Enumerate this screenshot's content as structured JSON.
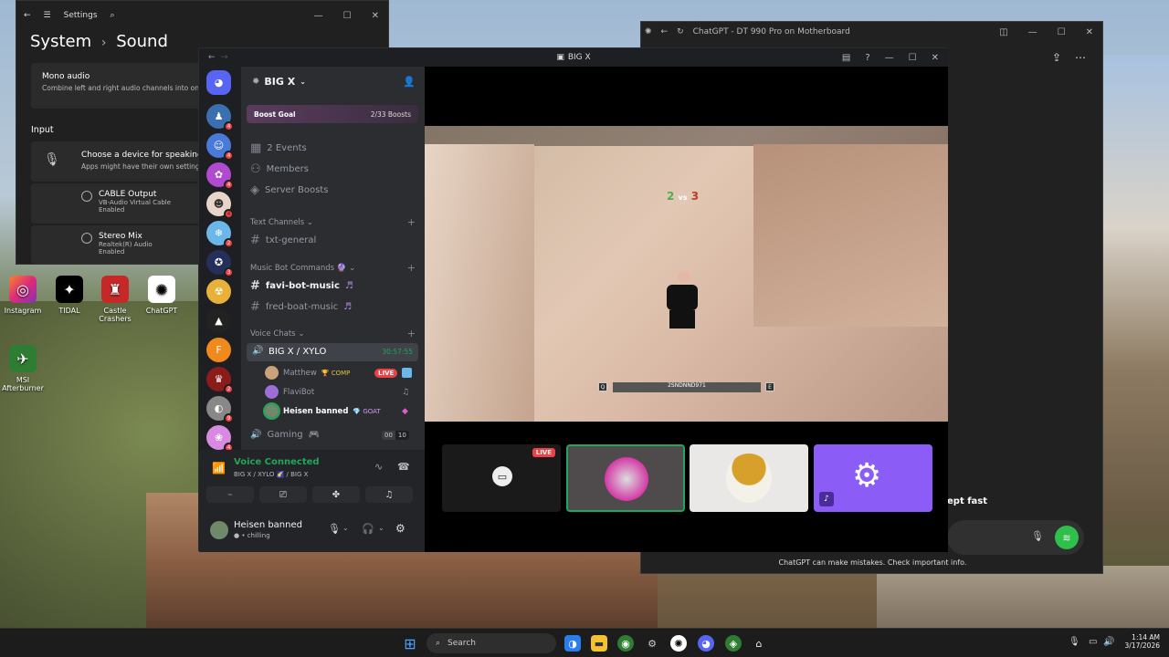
{
  "desktop": {
    "icons": [
      {
        "label": "Instagram",
        "glyph": "◎",
        "color": "#d6336c"
      },
      {
        "label": "TIDAL",
        "glyph": "✦",
        "color": "#000000"
      },
      {
        "label": "Castle Crashers",
        "glyph": "♜",
        "color": "#c62828"
      },
      {
        "label": "ChatGPT",
        "glyph": "✺",
        "color": "#ffffff"
      },
      {
        "label": "MSI Afterburner",
        "glyph": "✈",
        "color": "#2e7d32"
      }
    ]
  },
  "settings": {
    "title": "Settings",
    "breadcrumb_parent": "System",
    "breadcrumb_sep": "›",
    "breadcrumb_current": "Sound",
    "mono_title": "Mono audio",
    "mono_desc": "Combine left and right audio channels into one",
    "input_header": "Input",
    "choose_title": "Choose a device for speaking or re",
    "choose_desc": "Apps might have their own settings",
    "devices": [
      {
        "name": "CABLE Output",
        "sub": "VB-Audio Virtual Cable",
        "state": "Enabled"
      },
      {
        "name": "Stereo Mix",
        "sub": "Realtek(R) Audio",
        "state": "Enabled"
      }
    ]
  },
  "chatgpt": {
    "title": "ChatGPT - DT 990 Pro on Motherboard",
    "partial_text": "ept fast",
    "disclaimer": "ChatGPT can make mistakes. Check important info."
  },
  "discord": {
    "window_title": "BIG X",
    "server_name": "BIG X",
    "boost_goal_label": "Boost Goal",
    "boost_count": "2/33 Boosts",
    "events": "2 Events",
    "members": "Members",
    "server_boosts": "Server Boosts",
    "text_channels_cat": "Text Channels",
    "txt_general": "txt-general",
    "music_cat": "Music Bot Commands",
    "favi": "favi-bot-music",
    "fred": "fred-boat-music",
    "voice_cat": "Voice Chats",
    "voice_channel": "BIG X / XYLO",
    "voice_timer": "30:57:55",
    "voice_users": [
      {
        "name": "Matthew",
        "tag": "🏆 COMP",
        "live": "LIVE",
        "color": "#c9a27a"
      },
      {
        "name": "FlaviBot",
        "tag": "",
        "live": "",
        "color": "#9b6fd6"
      },
      {
        "name": "Heisen banned",
        "tag": "💎 GOAT",
        "live": "",
        "color": "#6f8a6a"
      }
    ],
    "gaming_channel": "Gaming",
    "gaming_count_a": "00",
    "gaming_count_b": "10",
    "voice_connected": "Voice Connected",
    "voice_connected_sub": "BIG X / XYLO 🌠 / BIG X",
    "username": "Heisen banned",
    "user_status": "chilling",
    "live_badge": "LIVE",
    "game_score_left": "2",
    "game_score_vs": "vs",
    "game_score_right": "3",
    "game_player_name": "2SNDNND971",
    "game_key_q": "Q",
    "game_key_e": "E",
    "guild_badges": [
      "4",
      "4",
      "4",
      "4",
      "2",
      "3",
      "2",
      "9",
      "4"
    ]
  },
  "taskbar": {
    "search_placeholder": "Search",
    "time": "1:14 AM",
    "date": "3/17/2026"
  }
}
